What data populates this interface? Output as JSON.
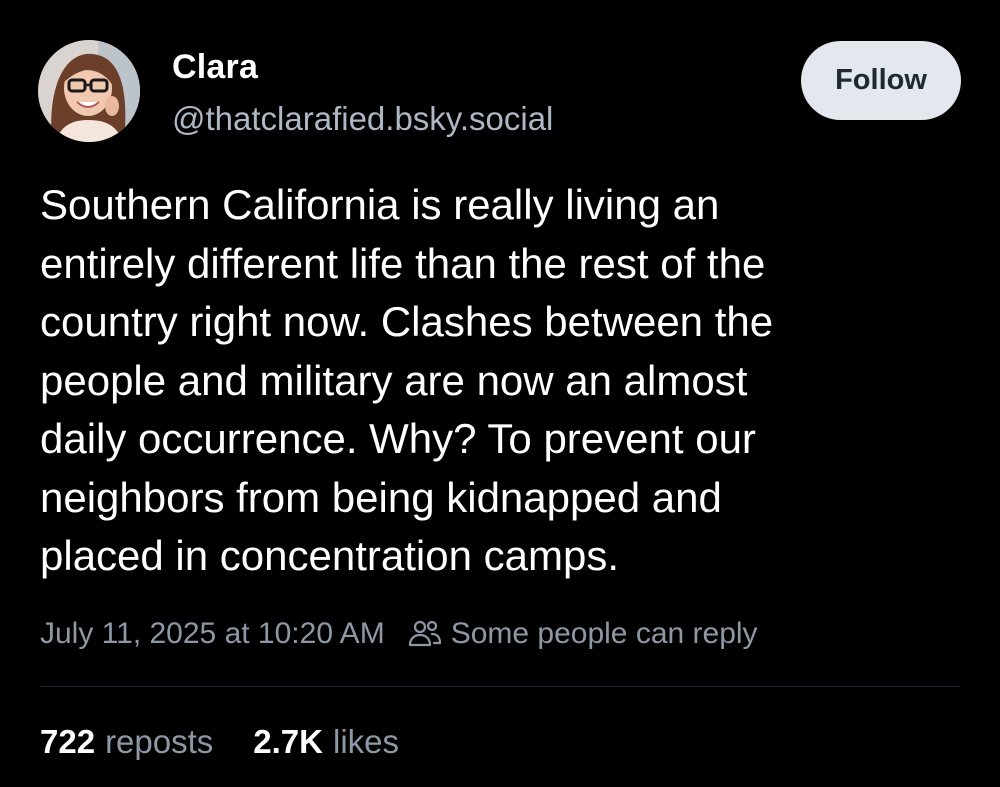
{
  "author": {
    "display_name": "Clara",
    "handle": "@thatclarafied.bsky.social",
    "avatar_icon": "profile-photo"
  },
  "follow_button": {
    "label": "Follow"
  },
  "post": {
    "lines": [
      "Southern California is really living an",
      "entirely different life than the rest of the",
      "country right now. Clashes between the",
      "people and military are now an almost",
      "daily occurrence. Why? To prevent our",
      "neighbors from being kidnapped and",
      "placed in concentration camps."
    ]
  },
  "meta": {
    "timestamp": "July 11, 2025 at 10:20 AM",
    "reply_icon": "people-icon",
    "reply_setting": "Some people can reply"
  },
  "stats": {
    "reposts_count": "722",
    "reposts_label": "reposts",
    "likes_count": "2.7K",
    "likes_label": "likes"
  },
  "colors": {
    "background": "#000000",
    "text": "#ffffff",
    "muted": "#8e98a5",
    "handle": "#aeb7c3",
    "button_bg": "#e3e8ef",
    "button_text": "#1e2934"
  }
}
